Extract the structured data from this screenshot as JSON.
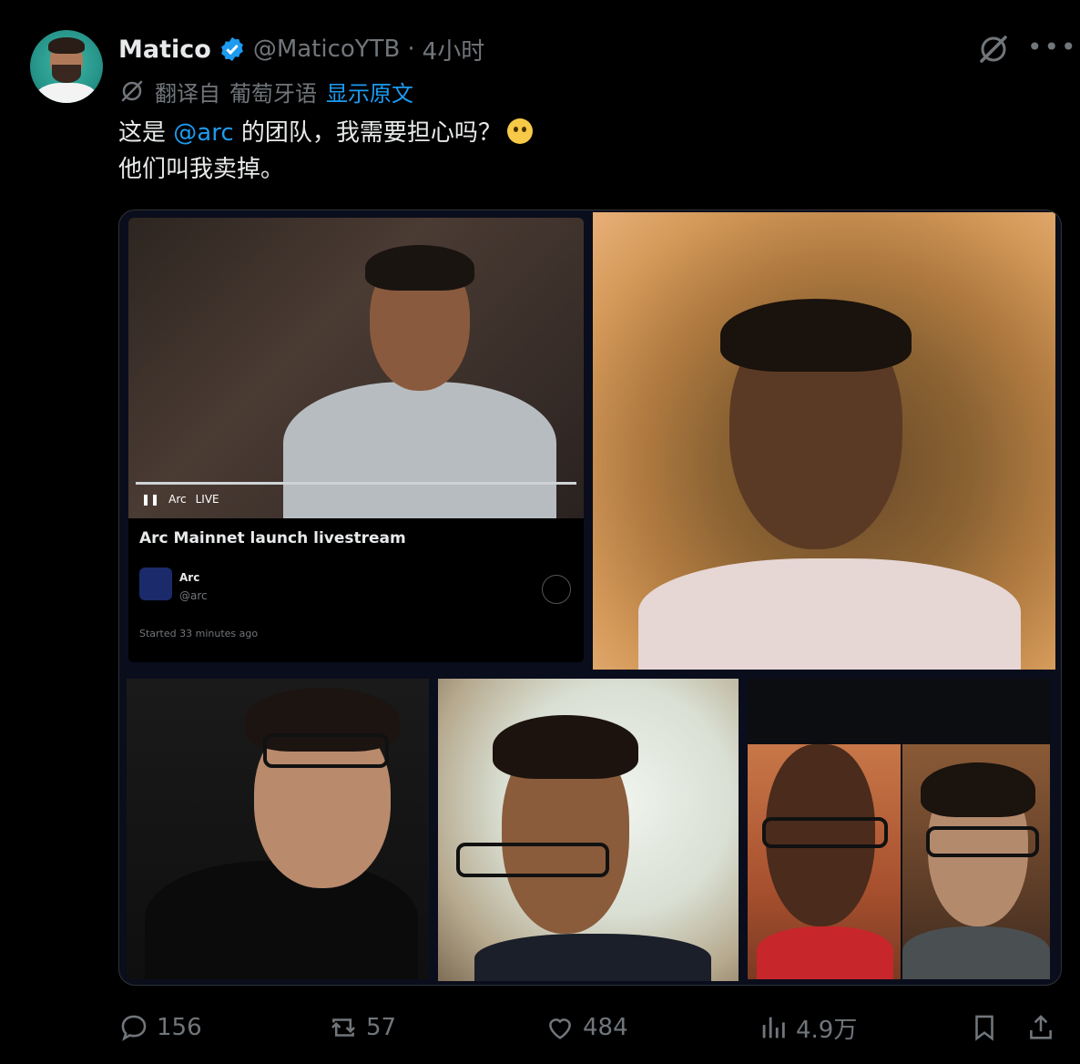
{
  "author": {
    "name": "Matico",
    "handle": "@MaticoYTB",
    "separator": "·",
    "time": "4小时"
  },
  "translation": {
    "label": "翻译自",
    "language": "葡萄牙语",
    "show_original": "显示原文"
  },
  "tweet": {
    "line1_pre": "这是 ",
    "mention": "@arc",
    "line1_post": " 的团队，我需要担心吗？",
    "line2": "他们叫我卖掉。"
  },
  "stream_card": {
    "live_label": "LIVE",
    "channel_short": "Arc",
    "title": "Arc Mainnet launch livestream",
    "account_name": "Arc",
    "account_handle": "@arc",
    "started": "Started 33 minutes ago"
  },
  "actions": {
    "replies": "156",
    "reposts": "57",
    "likes": "484",
    "views": "4.9万"
  },
  "colors": {
    "accent": "#1d9bf0",
    "muted": "#71767b",
    "text": "#e7e9ea",
    "background": "#000000"
  },
  "icons": [
    "verified-badge-icon",
    "grok-icon",
    "more-icon",
    "translate-icon",
    "reply-icon",
    "repost-icon",
    "like-icon",
    "views-icon",
    "bookmark-icon",
    "share-icon"
  ]
}
